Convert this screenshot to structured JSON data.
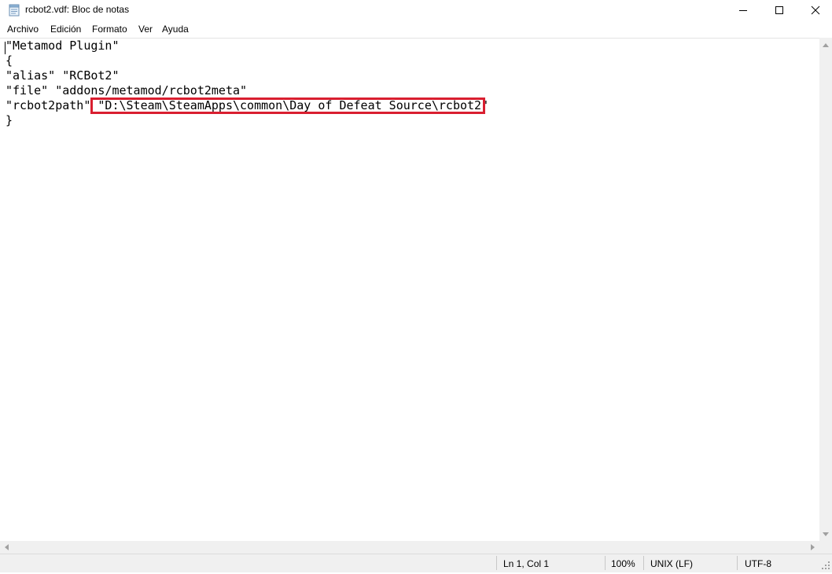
{
  "window": {
    "title": "rcbot2.vdf: Bloc de notas"
  },
  "menu": [
    {
      "label": "Archivo"
    },
    {
      "label": "Edición"
    },
    {
      "label": "Formato"
    },
    {
      "label": "Ver"
    },
    {
      "label": "Ayuda"
    }
  ],
  "editor": {
    "lines": [
      "\"Metamod Plugin\"",
      "{",
      "\"alias\" \"RCBot2\"",
      "\"file\" \"addons/metamod/rcbot2meta\"",
      "\"rcbot2path\" \"D:\\Steam\\SteamApps\\common\\Day of Defeat Source\\rcbot2\"",
      "}"
    ]
  },
  "status": {
    "position": "Ln 1, Col 1",
    "zoom": "100%",
    "line_ending": "UNIX (LF)",
    "encoding": "UTF-8"
  },
  "colors": {
    "highlight": "#d91f30",
    "status_bg": "#f0f0f0"
  },
  "icons": {
    "app": "notepad-icon",
    "minimize": "minimize-icon",
    "maximize": "maximize-icon",
    "close": "close-icon"
  }
}
